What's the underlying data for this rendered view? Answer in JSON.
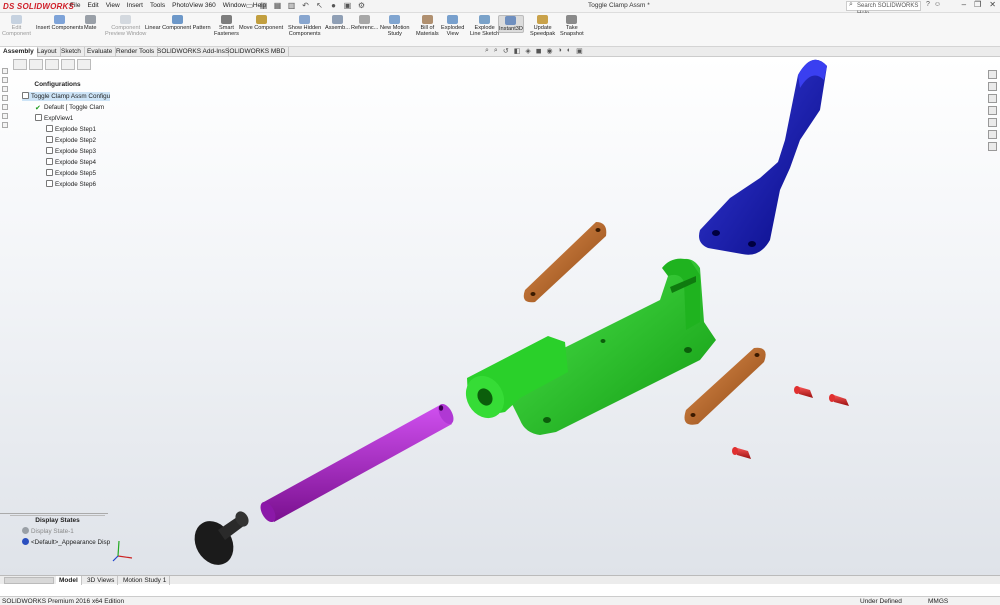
{
  "app": {
    "logo": "DS SOLIDWORKS",
    "doc_title": "Toggle Clamp Assm *"
  },
  "menu": [
    "File",
    "Edit",
    "View",
    "Insert",
    "Tools",
    "PhotoView 360",
    "Window",
    "Help"
  ],
  "search": {
    "placeholder": "Search SOLIDWORKS Help"
  },
  "commands": [
    {
      "label": "Edit\nComponent",
      "dim": true,
      "color": "#8aa3c4"
    },
    {
      "label": "Insert Components",
      "dim": false,
      "color": "#7ea3d8"
    },
    {
      "label": "Mate",
      "dim": false,
      "color": "#9aa0a8"
    },
    {
      "label": "Component\nPreview Window",
      "dim": true,
      "color": "#a8b3c1"
    },
    {
      "label": "Linear Component Pattern",
      "dim": false,
      "color": "#6d98c9"
    },
    {
      "label": "Smart\nFasteners",
      "dim": false,
      "color": "#7d7d7d"
    },
    {
      "label": "Move Component",
      "dim": false,
      "color": "#c29f3f"
    },
    {
      "label": "Show Hidden\nComponents",
      "dim": false,
      "color": "#88a6cf"
    },
    {
      "label": "Assemb...",
      "dim": false,
      "color": "#8f9fb5"
    },
    {
      "label": "Referenc...",
      "dim": false,
      "color": "#a7a7a7"
    },
    {
      "label": "New Motion\nStudy",
      "dim": false,
      "color": "#80a5d0"
    },
    {
      "label": "Bill of\nMaterials",
      "dim": false,
      "color": "#b09070"
    },
    {
      "label": "Exploded\nView",
      "dim": false,
      "color": "#78a0cd"
    },
    {
      "label": "Explode\nLine Sketch",
      "dim": false,
      "color": "#7aa2c9"
    },
    {
      "label": "Instant3D",
      "dim": false,
      "active": true,
      "color": "#6f8fbf"
    },
    {
      "label": "Update\nSpeedpak",
      "dim": false,
      "color": "#c9a24a"
    },
    {
      "label": "Take\nSnapshot",
      "dim": false,
      "color": "#8a8a8a"
    }
  ],
  "tabs": [
    "Assembly",
    "Layout",
    "Sketch",
    "Evaluate",
    "Render Tools",
    "SOLIDWORKS Add-Ins",
    "SOLIDWORKS MBD"
  ],
  "feature_manager": {
    "title": "Configurations",
    "tree": [
      {
        "label": "Toggle Clamp Assm Configu",
        "selected": true
      },
      {
        "label": "Default [ Toggle Clam"
      },
      {
        "label": "ExplView1"
      },
      {
        "label": "Explode Step1"
      },
      {
        "label": "Explode Step2"
      },
      {
        "label": "Explode Step3"
      },
      {
        "label": "Explode Step4"
      },
      {
        "label": "Explode Step5"
      },
      {
        "label": "Explode Step6"
      }
    ],
    "display_states_title": "Display States",
    "display_states": [
      {
        "label": "Display State-1",
        "color": "#9aa0a6"
      },
      {
        "label": "<Default>_Appearance Disp",
        "color": "#2b4fbf"
      }
    ]
  },
  "bottom_tabs": [
    "Model",
    "3D Views",
    "Motion Study 1"
  ],
  "status": {
    "edition": "SOLIDWORKS Premium 2016 x64 Edition",
    "state": "Under Defined",
    "units": "MMGS"
  },
  "colors": {
    "base_green": "#22cc22",
    "handle_blue": "#0a0fb4",
    "link_brown": "#b8651f",
    "rod_purple": "#a020c8",
    "pin_red": "#cc1a1a",
    "knob_black": "#1a1a1a"
  }
}
